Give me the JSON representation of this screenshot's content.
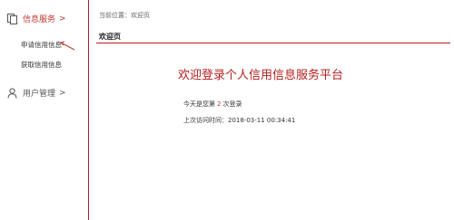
{
  "sidebar": {
    "info_service": {
      "label": "信息服务",
      "chevron": ">"
    },
    "items": [
      {
        "label": "申请信用信息"
      },
      {
        "label": "获取信用信息"
      }
    ],
    "user_management": {
      "label": "用户管理",
      "chevron": ">"
    }
  },
  "breadcrumb": {
    "text": "当前位置：欢迎页"
  },
  "page": {
    "title": "欢迎页"
  },
  "welcome": {
    "heading": "欢迎登录个人信用信息服务平台",
    "login_count_prefix": "今天是您第",
    "login_count": "2",
    "login_count_suffix": "次登录",
    "last_visit_label": "上次访问时间：",
    "last_visit_time": "2018-03-11 00:34:41"
  },
  "colors": {
    "accent": "#b51c1c",
    "text": "#333333",
    "muted": "#666666"
  },
  "icons": {
    "info_service": "document-icon",
    "user_management": "user-icon",
    "annotation": "arrow-icon"
  }
}
